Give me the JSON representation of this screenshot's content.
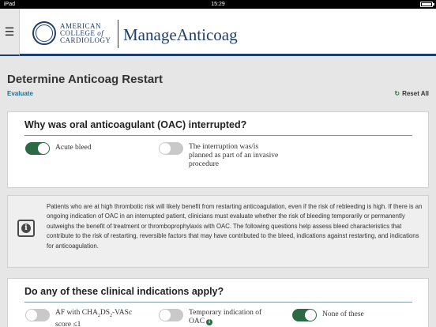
{
  "status": {
    "device": "iPad",
    "time": "15:29"
  },
  "header": {
    "logo_lines": [
      "AMERICAN",
      "COLLEGE",
      "of",
      "CARDIOLOGY"
    ],
    "app_name": "ManageAnticoag"
  },
  "page": {
    "title": "Determine Anticoag Restart",
    "breadcrumb": "Evaluate",
    "reset_label": "Reset All"
  },
  "q1": {
    "title": "Why was oral anticoagulant (OAC) interrupted?",
    "options": [
      {
        "label": "Acute bleed",
        "on": true
      },
      {
        "label": "The interruption was/is planned as part of an invasive procedure",
        "on": false
      }
    ]
  },
  "info": {
    "text": "Patients who are at high thrombotic risk will likely benefit from restarting anticoagulation, even if the risk of rebleeding is high. If there is an ongoing indication of OAC in an interrupted patient, clinicians must evaluate whether the risk of bleeding temporarily or permanently outweighs the benefit of treatment or thromboprophylaxis with OAC. The following questions help assess bleed characteristics that contribute to the risk of restarting, reversible factors that may have contributed to the bleed, indications against restarting, and indications for anticoagulation."
  },
  "q2": {
    "title": "Do any of these clinical indications apply?",
    "options": [
      {
        "label_prefix": "AF with CHA",
        "sub1": "2",
        "label_mid": "DS",
        "sub2": "2",
        "label_suffix": "-VASc score ≤1",
        "on": false
      },
      {
        "label": "Temporary indication of OAC",
        "on": false
      },
      {
        "label": "None of these",
        "on": true
      }
    ]
  },
  "colors": {
    "brand": "#1e3f6e",
    "toggle_on": "#2b6b43",
    "link": "#1f6f8b"
  }
}
